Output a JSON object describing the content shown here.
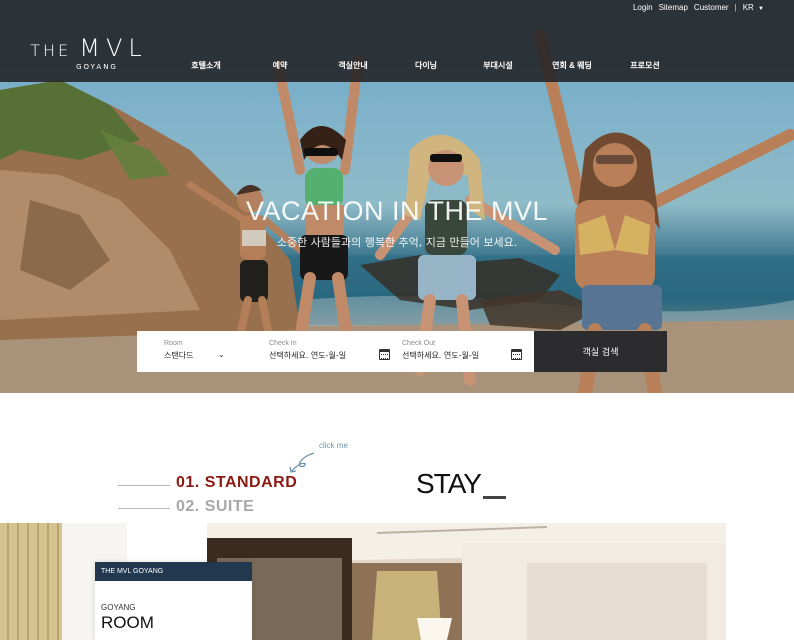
{
  "header": {
    "utility_links": [
      "Login",
      "Sitemap",
      "Customer"
    ],
    "language": "KR",
    "logo": {
      "word1": "THE",
      "word2": "MVL",
      "sub": "GOYANG"
    },
    "nav": [
      "호텔소개",
      "예약",
      "객실안내",
      "다이닝",
      "부대시설",
      "연회 & 웨딩",
      "프로모션"
    ]
  },
  "hero": {
    "title": "VACATION IN THE MVL",
    "subtitle": "소중한 사람들과의 행복한 추억, 지금 만들어 보세요."
  },
  "booking": {
    "room": {
      "label": "Room",
      "value": "스탠다드"
    },
    "check_in": {
      "label": "Check In",
      "value": "선택하세요.  연도-월-일"
    },
    "check_out": {
      "label": "Check Out",
      "value": "선택하세요.  연도-월-일"
    },
    "search_label": "객실 검색"
  },
  "rooms": {
    "hint": "click me",
    "tabs": [
      "01. STANDARD",
      "02. SUITE"
    ],
    "heading": "STAY",
    "card": {
      "header": "THE MVL GOYANG",
      "small": "GOYANG",
      "big": "ROOM"
    }
  },
  "colors": {
    "header_bg": "#222224",
    "accent_red": "#8c1a12",
    "card_header": "#22384f",
    "search_btn": "#2c2c2e"
  },
  "icons": {
    "language_caret": "caret-down-icon",
    "room_select": "chevron-down-icon",
    "date_picker": "calendar-icon",
    "hint_arrow": "curved-arrow-icon"
  }
}
